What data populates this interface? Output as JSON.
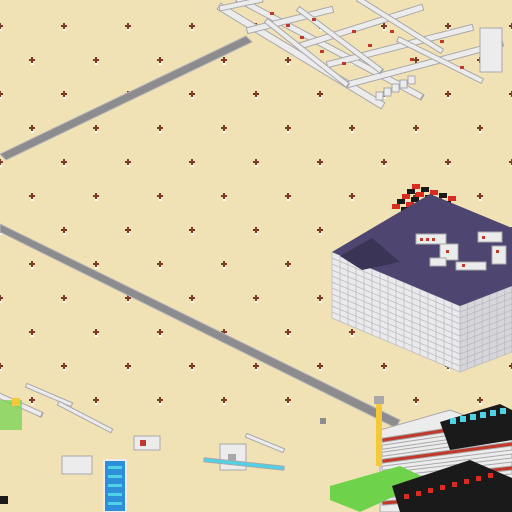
{
  "scene": {
    "description_kind": "isometric voxel world top-down view",
    "colors": {
      "ground": "#f1e2b6",
      "ground_dots": "#e6d39f",
      "road": "#8c8c8e",
      "road_edge": "#b5b5b8",
      "factory_roof": "#4e4670",
      "factory_roof_dark": "#3a3456",
      "factory_wall_left": "#eaeaec",
      "factory_wall_right": "#d6d6da",
      "factory_grid": "#b8b8bf",
      "belt_white": "#ececec",
      "belt_gray": "#a8a8ab",
      "belt_red": "#c0392b",
      "checker_red": "#d92b1f",
      "checker_black": "#1a1a1a",
      "accent_green": "#6ed34a",
      "accent_blue": "#2d8fd8",
      "accent_cyan": "#4fd1e6",
      "accent_yellow": "#f3c93a",
      "marker_dark": "#7a3a2a",
      "marker_light": "#ffffff"
    },
    "icons": {
      "ground_marker": "cross-marker-icon",
      "checker": "checkerboard-icon"
    }
  }
}
